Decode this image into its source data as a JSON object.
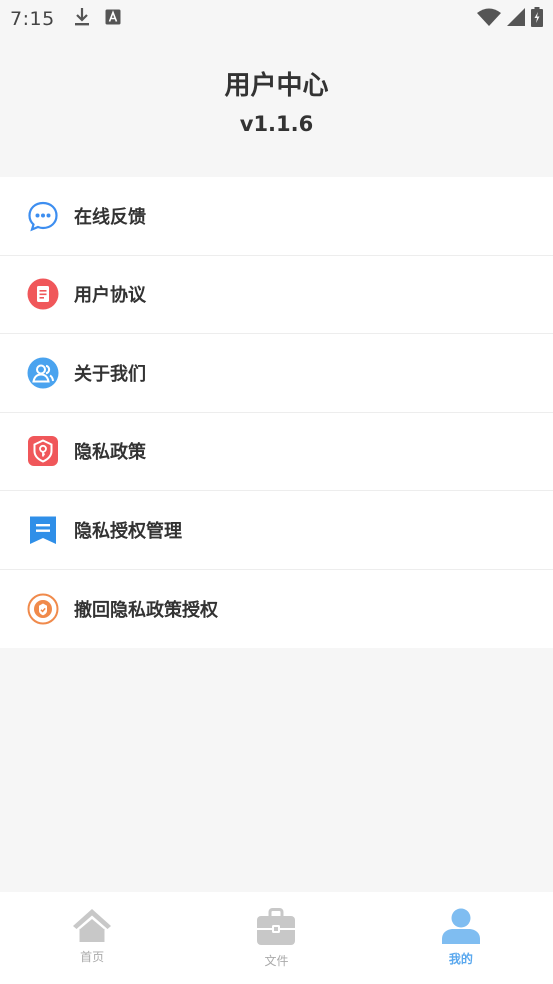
{
  "status_bar": {
    "time": "7:15",
    "left_icons": [
      "download-icon",
      "a-box-icon"
    ],
    "right_icons": [
      "wifi-icon",
      "cell-signal-icon",
      "battery-icon"
    ]
  },
  "header": {
    "title": "用户中心",
    "version": "v1.1.6"
  },
  "menu": {
    "items": [
      {
        "label": "在线反馈",
        "icon": "chat-bubble-icon",
        "color": "#3d8ef0"
      },
      {
        "label": "用户协议",
        "icon": "document-icon",
        "color": "#f0575a"
      },
      {
        "label": "关于我们",
        "icon": "users-icon",
        "color": "#4aa3ef"
      },
      {
        "label": "隐私政策",
        "icon": "shield-key-icon",
        "color": "#f0575a"
      },
      {
        "label": "隐私授权管理",
        "icon": "bookmark-list-icon",
        "color": "#2f8fe8"
      },
      {
        "label": "撤回隐私政策授权",
        "icon": "revoke-badge-icon",
        "color": "#f08a4b"
      }
    ]
  },
  "tabbar": {
    "tabs": [
      {
        "label": "首页",
        "icon": "home-icon",
        "active": false
      },
      {
        "label": "文件",
        "icon": "briefcase-icon",
        "active": false
      },
      {
        "label": "我的",
        "icon": "person-icon",
        "active": true
      }
    ],
    "active_color": "#5aa8ee",
    "inactive_color": "#c8c8c8"
  }
}
